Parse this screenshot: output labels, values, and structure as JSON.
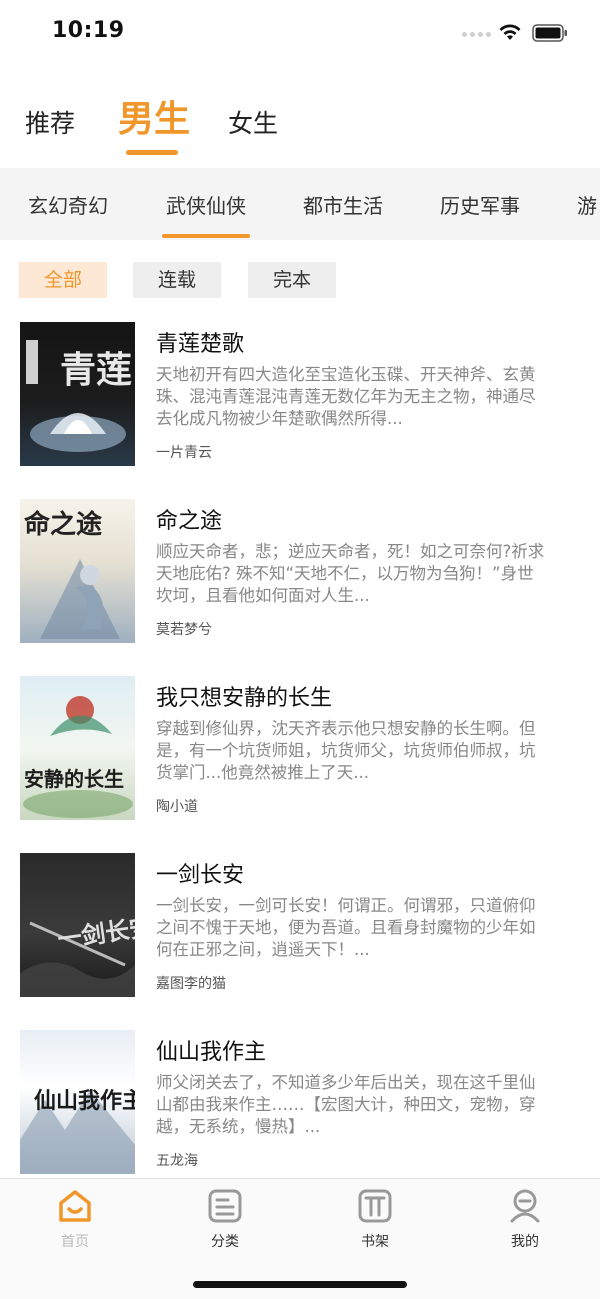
{
  "status_bar": {
    "time": "10:19"
  },
  "top_tabs": [
    {
      "label": "推荐",
      "active": false
    },
    {
      "label": "男生",
      "active": true
    },
    {
      "label": "女生",
      "active": false
    }
  ],
  "categories": [
    "玄幻奇幻",
    "武侠仙侠",
    "都市生活",
    "历史军事",
    "游"
  ],
  "active_category": "武侠仙侠",
  "filters": [
    {
      "label": "全部",
      "active": true
    },
    {
      "label": "连载",
      "active": false
    },
    {
      "label": "完本",
      "active": false
    }
  ],
  "books": [
    {
      "title": "青莲楚歌",
      "description": "天地初开有四大造化至宝造化玉碟、开天神斧、玄黄珠、混沌青莲混沌青莲无数亿年为无主之物，神通尽去化成凡物被少年楚歌偶然所得...",
      "author": "一片青云",
      "cover_text": "青莲"
    },
    {
      "title": "命之途",
      "description": "顺应天命者，悲；逆应天命者，死！如之可奈何?祈求天地庇佑? 殊不知“天地不仁，以万物为刍狗！”身世坎坷，且看他如何面对人生...",
      "author": "莫若梦兮",
      "cover_text": "命之途"
    },
    {
      "title": "我只想安静的长生",
      "description": "穿越到修仙界，沈天齐表示他只想安静的长生啊。但是，有一个坑货师姐，坑货师父，坑货师伯师叔，坑货掌门...他竟然被推上了天...",
      "author": "陶小道",
      "cover_text": "安静的长生"
    },
    {
      "title": "一剑长安",
      "description": "一剑长安，一剑可长安！何谓正。何谓邪，只道俯仰之间不愧于天地，便为吾道。且看身封魔物的少年如何在正邪之间，逍遥天下！...",
      "author": "嘉图李的猫",
      "cover_text": "一剑长安"
    },
    {
      "title": "仙山我作主",
      "description": "师父闭关去了，不知道多少年后出关，现在这千里仙山都由我来作主……【宏图大计，种田文，宠物，穿越，无系统，慢热】...",
      "author": "五龙海",
      "cover_text": "仙山我作主"
    }
  ],
  "tab_bar": [
    {
      "label": "首页",
      "icon": "home-icon",
      "active": true
    },
    {
      "label": "分类",
      "icon": "category-icon",
      "active": false
    },
    {
      "label": "书架",
      "icon": "bookshelf-icon",
      "active": false
    },
    {
      "label": "我的",
      "icon": "profile-icon",
      "active": false
    }
  ],
  "colors": {
    "accent": "#f0962a",
    "chip_active_bg": "#fde8d6",
    "category_bg": "#f4f4f4"
  }
}
